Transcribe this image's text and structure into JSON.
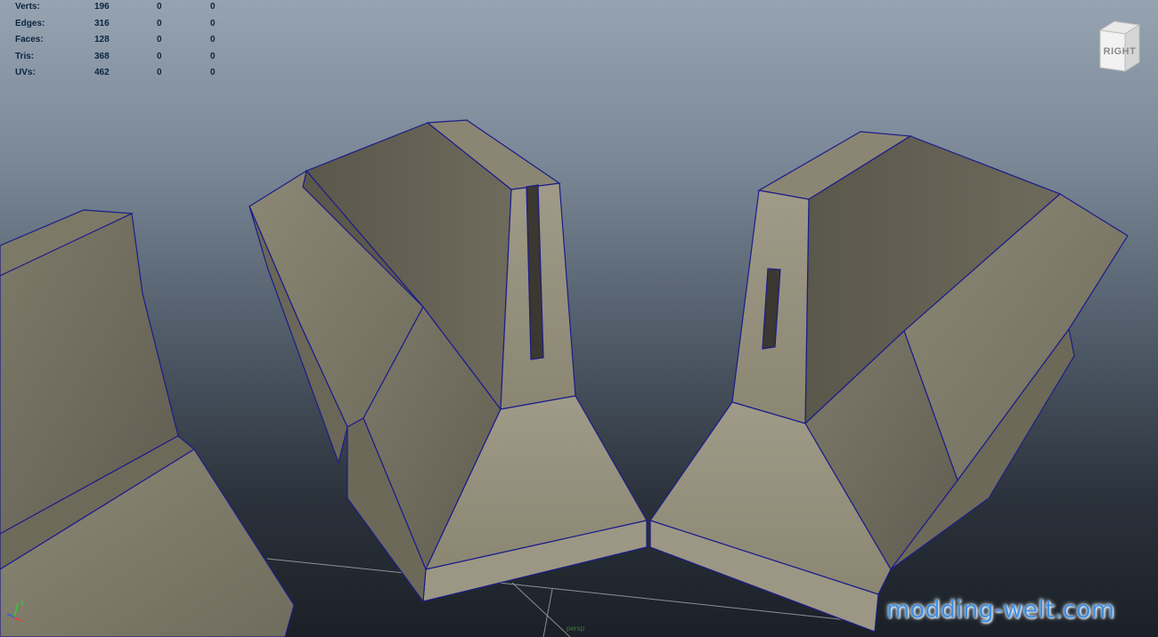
{
  "hud": {
    "rows": [
      {
        "label": "Verts:",
        "v1": "196",
        "v2": "0",
        "v3": "0"
      },
      {
        "label": "Edges:",
        "v1": "316",
        "v2": "0",
        "v3": "0"
      },
      {
        "label": "Faces:",
        "v1": "128",
        "v2": "0",
        "v3": "0"
      },
      {
        "label": "Tris:",
        "v1": "368",
        "v2": "0",
        "v3": "0"
      },
      {
        "label": "UVs:",
        "v1": "462",
        "v2": "0",
        "v3": "0"
      }
    ]
  },
  "viewcube": {
    "label": "RIGHT",
    "icon": "view-cube-icon"
  },
  "camera": {
    "label": "persp"
  },
  "axis": {
    "y_label": "y",
    "icon": "axis-gizmo-icon"
  },
  "watermark": {
    "text": "modding-welt.com"
  },
  "colors": {
    "wireframe": "#1c1c8a",
    "concrete": "#8a8574",
    "background_top": "#96a3b1",
    "background_bottom": "#1b2027",
    "hud_text": "#0b2440",
    "watermark": "#3f8fe0"
  }
}
